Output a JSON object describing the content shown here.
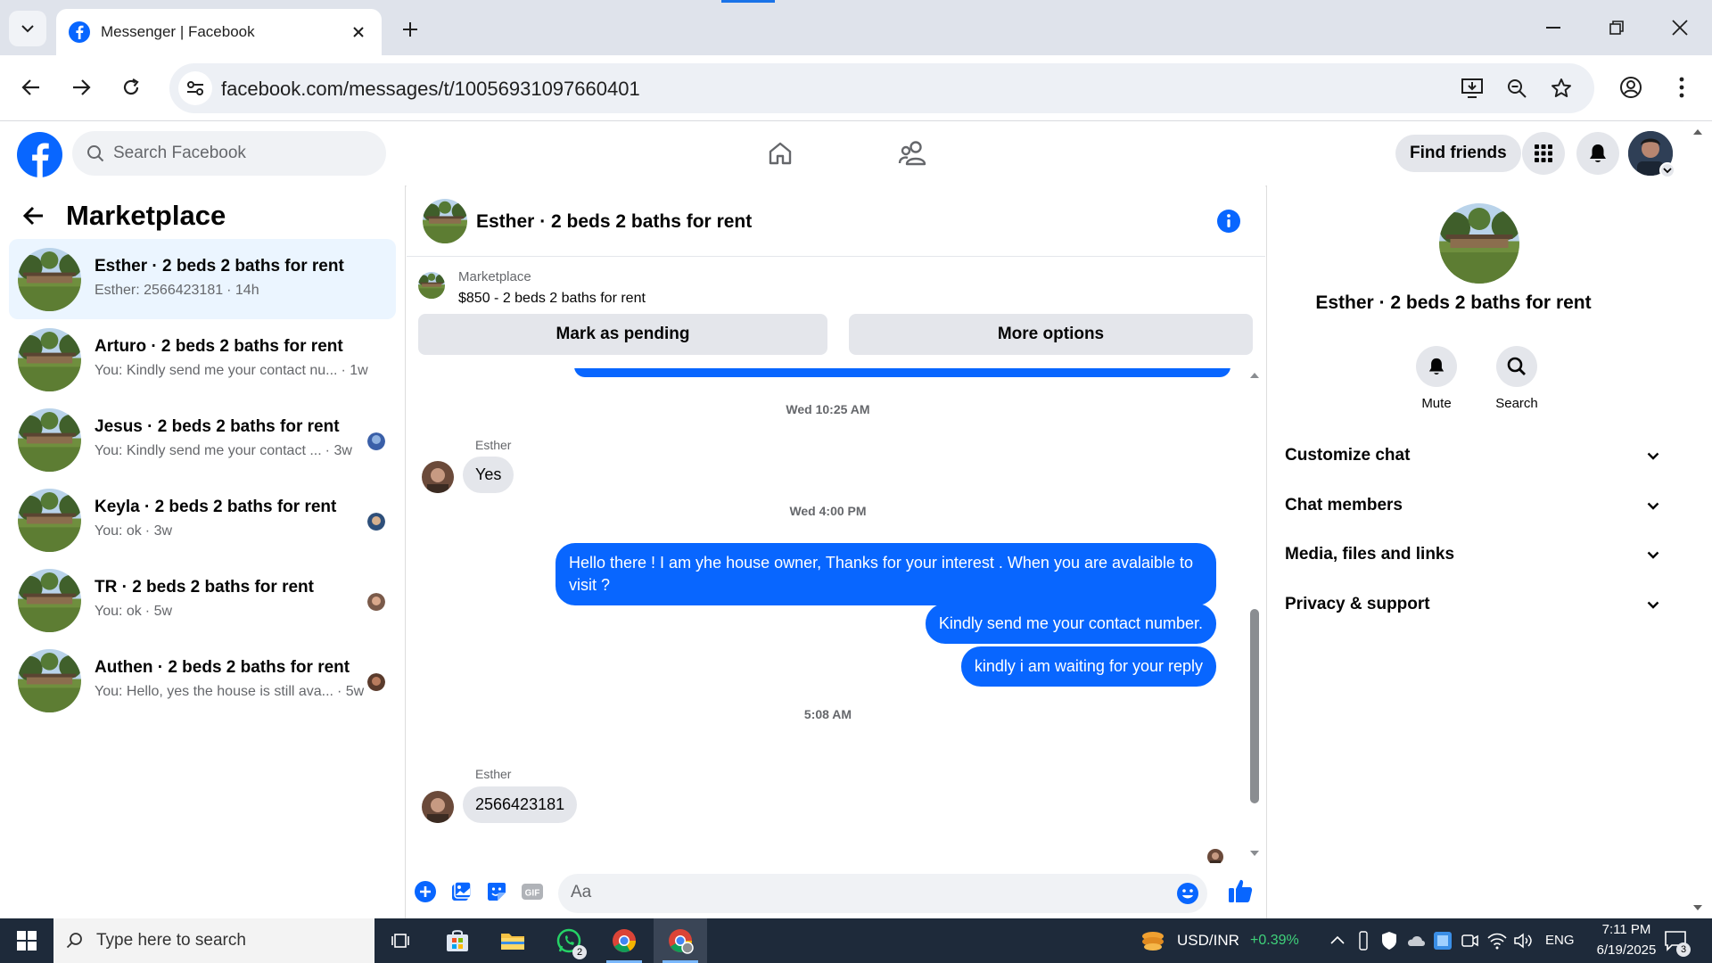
{
  "browser": {
    "tab_title": "Messenger | Facebook",
    "url": "facebook.com/messages/t/10056931097660401"
  },
  "fb": {
    "search_placeholder": "Search Facebook",
    "find_friends": "Find friends"
  },
  "left": {
    "title": "Marketplace",
    "conversations": [
      {
        "name": "Esther · 2 beds 2 baths for rent",
        "preview": "Esther: 2566423181",
        "time": "· 14h"
      },
      {
        "name": "Arturo · 2 beds 2 baths for rent",
        "preview": "You: Kindly send me your contact nu...",
        "time": "· 1w"
      },
      {
        "name": "Jesus · 2 beds 2 baths for rent",
        "preview": "You: Kindly send me your contact ...",
        "time": "· 3w"
      },
      {
        "name": "Keyla · 2 beds 2 baths for rent",
        "preview": "You: ok",
        "time": "· 3w"
      },
      {
        "name": "TR · 2 beds 2 baths for rent",
        "preview": "You: ok",
        "time": "· 5w"
      },
      {
        "name": "Authen · 2 beds 2 baths for rent",
        "preview": "You: Hello, yes the house is still ava...",
        "time": "· 5w"
      }
    ]
  },
  "chat": {
    "title": "Esther · 2 beds 2 baths for rent",
    "listing_label": "Marketplace",
    "listing_price": "$850 - 2 beds 2 baths for rent",
    "mark_pending": "Mark as pending",
    "more_options": "More options",
    "messages": {
      "ts1": "Wed 10:25 AM",
      "sender1": "Esther",
      "in1": "Yes",
      "ts2": "Wed 4:00 PM",
      "out1": "Hello there ! I am yhe house owner, Thanks for your interest . When you are avalaible to visit ?",
      "out2": "Kindly send me your contact number.",
      "out3": "kindly i am waiting for your reply",
      "ts3": "5:08 AM",
      "sender2": "Esther",
      "in2": "2566423181"
    },
    "composer_placeholder": "Aa"
  },
  "right": {
    "title": "Esther · 2 beds 2 baths for rent",
    "mute": "Mute",
    "search": "Search",
    "sections": [
      "Customize chat",
      "Chat members",
      "Media, files and links",
      "Privacy & support"
    ]
  },
  "taskbar": {
    "search_placeholder": "Type here to search",
    "whatsapp_badge": "2",
    "currency": "USD/INR",
    "currency_change": "+0.39%",
    "lang": "ENG",
    "time": "7:11 PM",
    "date": "6/19/2025",
    "notif_count": "3"
  },
  "colors": {
    "fb_blue": "#0866ff",
    "active_conv": "#ebf5ff",
    "taskbar": "#1e2a3a",
    "positive": "#3fd17a"
  }
}
